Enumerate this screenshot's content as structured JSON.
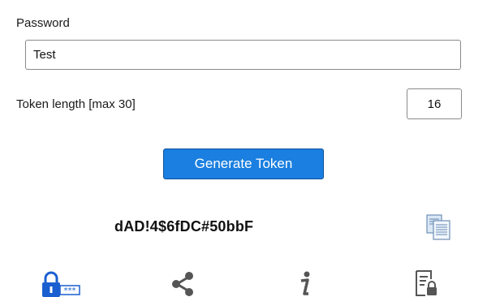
{
  "form": {
    "password_label": "Password",
    "password_value": "Test",
    "token_length_label": "Token length [max 30]",
    "token_length_value": "16",
    "generate_label": "Generate Token"
  },
  "result": {
    "token": "dAD!4$6fDC#50bbF"
  },
  "colors": {
    "primary_button": "#1a7fe0",
    "icon_blue": "#1a5fd0",
    "icon_gray": "#555555"
  },
  "bottom_bar": {
    "icons": [
      "lock-password-icon",
      "share-icon",
      "info-icon",
      "secure-document-icon"
    ]
  }
}
